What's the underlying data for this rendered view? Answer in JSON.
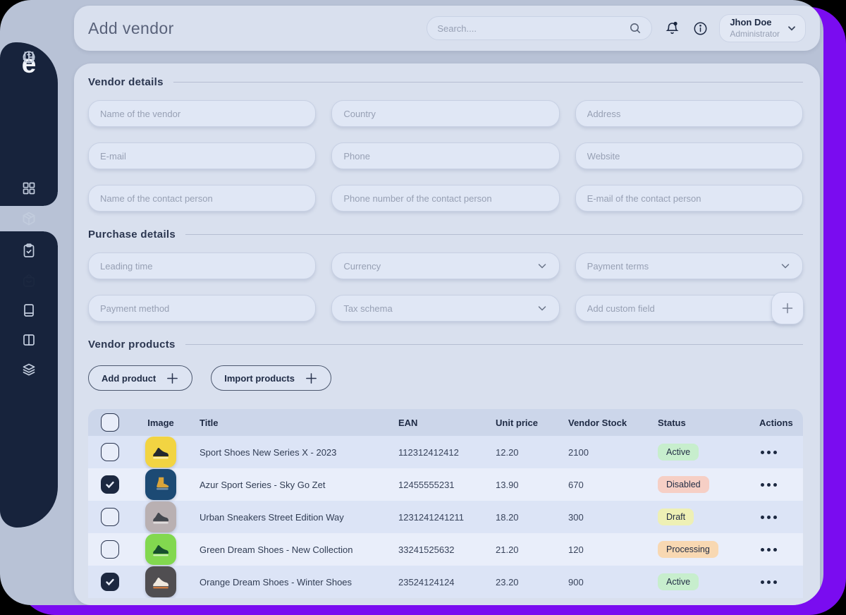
{
  "window": {
    "title": "Add vendor"
  },
  "colors": {
    "accent_purple": "#7a0cf0",
    "sidebar_navy": "#17233c",
    "frame_gray": "#b8c2d6",
    "card": "#d9e0ee"
  },
  "topbar": {
    "search": {
      "placeholder": "Search....",
      "icon": "magnifier-icon"
    },
    "notifications": {
      "icon": "bell-icon",
      "has_unread": true
    },
    "help": {
      "icon": "info-circle-icon"
    },
    "user": {
      "name": "Jhon Doe",
      "role": "Administrator",
      "chevron": "chevron-down-icon"
    }
  },
  "sidebar": {
    "logo": "e",
    "items": [
      {
        "icon": "dashboard-grid",
        "active": false
      },
      {
        "icon": "package-box",
        "active": false
      },
      {
        "icon": "clipboard-check",
        "active": false
      },
      {
        "icon": "shopping-bag",
        "active": true
      },
      {
        "icon": "book",
        "active": false
      },
      {
        "icon": "split-columns",
        "active": false
      },
      {
        "icon": "layers",
        "active": false
      },
      {
        "icon": "pie-chart",
        "active": false
      },
      {
        "icon": "sliders",
        "active": false
      }
    ]
  },
  "vendor_details": {
    "title": "Vendor details",
    "fields": [
      "Name of the vendor",
      "Country",
      "Address",
      "E-mail",
      "Phone",
      "Website",
      "Name of the contact person",
      "Phone number of the contact person",
      "E-mail of the contact person"
    ]
  },
  "purchase_details": {
    "title": "Purchase details",
    "fields": [
      {
        "label": "Leading time",
        "type": "text"
      },
      {
        "label": "Currency",
        "type": "select"
      },
      {
        "label": "Payment terms",
        "type": "select"
      },
      {
        "label": "Payment method",
        "type": "text"
      },
      {
        "label": "Tax schema",
        "type": "select"
      },
      {
        "label": "Add custom field",
        "type": "text_with_add"
      }
    ]
  },
  "vendor_products": {
    "title": "Vendor products",
    "add_button": "Add product",
    "import_button": "Import products"
  },
  "table": {
    "columns": [
      "Image",
      "Title",
      "EAN",
      "Unit price",
      "Vendor Stock",
      "Status",
      "Actions"
    ],
    "rows": [
      {
        "checked": false,
        "image_icon": "sneaker",
        "image_bg": "#f2d442",
        "shoe_color": "#23282e",
        "title": "Sport Shoes New Series X - 2023",
        "ean": "112312412412",
        "unit_price": "12.20",
        "vendor_stock": "2100",
        "status": "Active",
        "status_bg": "#c7eecd"
      },
      {
        "checked": true,
        "image_icon": "boot",
        "image_bg": "#1c4a74",
        "shoe_color": "#d9a43a",
        "title": "Azur Sport Series - Sky Go Zet",
        "ean": "12455555231",
        "unit_price": "13.90",
        "vendor_stock": "670",
        "status": "Disabled",
        "status_bg": "#f6cfc5"
      },
      {
        "checked": false,
        "image_icon": "sneaker",
        "image_bg": "#b9b0b2",
        "shoe_color": "#43474e",
        "title": "Urban Sneakers Street Edition Way",
        "ean": "1231241241211",
        "unit_price": "18.20",
        "vendor_stock": "300",
        "status": "Draft",
        "status_bg": "#eef0b5"
      },
      {
        "checked": false,
        "image_icon": "sneaker",
        "image_bg": "#82d84f",
        "shoe_color": "#174f2d",
        "title": "Green Dream Shoes - New Collection",
        "ean": "33241525632",
        "unit_price": "21.20",
        "vendor_stock": "120",
        "status": "Processing",
        "status_bg": "#f8d8b2"
      },
      {
        "checked": true,
        "image_icon": "sneaker",
        "image_bg": "#504e51",
        "shoe_color": "#efe9df",
        "title": "Orange Dream Shoes - Winter Shoes",
        "ean": "23524124124",
        "unit_price": "23.20",
        "vendor_stock": "900",
        "status": "Active",
        "status_bg": "#c7eecd"
      }
    ]
  }
}
